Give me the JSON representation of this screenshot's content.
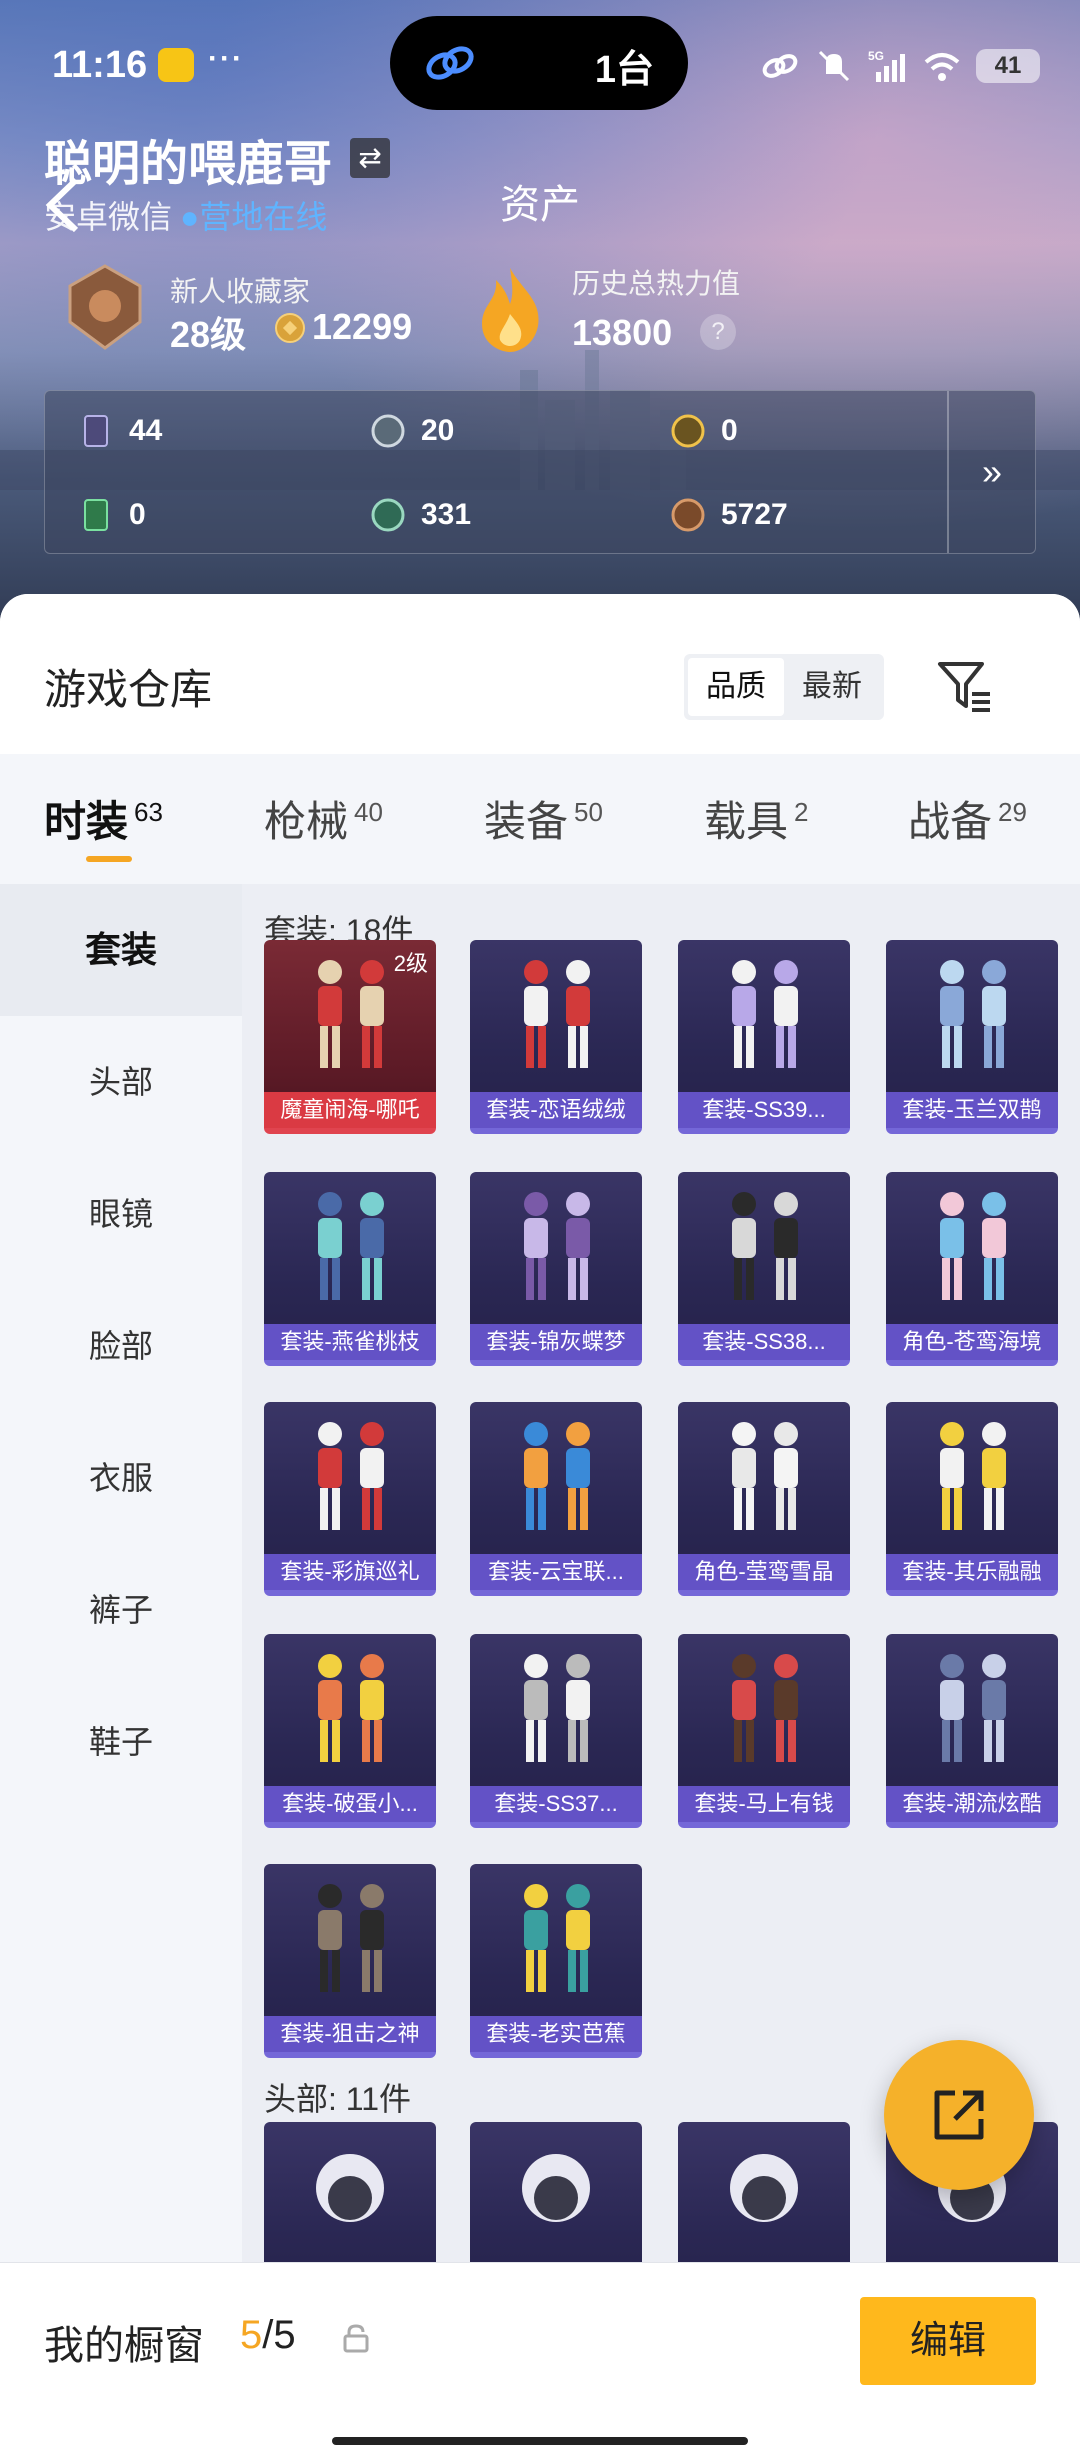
{
  "statusbar": {
    "time": "11:16",
    "dots": "···",
    "island_text": "1台",
    "battery": "41"
  },
  "header": {
    "title": "资产",
    "user_name": "聪明的喂鹿哥",
    "platform": "安卓微信",
    "online": "●营地在线",
    "collector_label": "新人收藏家",
    "level": "28级",
    "coins": "12299",
    "heat_label": "历史总热力值",
    "heat_value": "13800",
    "help": "?"
  },
  "assets": [
    {
      "value": "44",
      "icon": "card-icon"
    },
    {
      "value": "20",
      "icon": "silver-coin-icon"
    },
    {
      "value": "0",
      "icon": "gold-coin-icon"
    },
    {
      "value": "0",
      "icon": "ticket-icon"
    },
    {
      "value": "331",
      "icon": "green-orb-icon"
    },
    {
      "value": "5727",
      "icon": "bronze-coin-icon"
    }
  ],
  "assets_more": "»",
  "warehouse": {
    "title": "游戏仓库",
    "sort_options": [
      "品质",
      "最新"
    ],
    "tabs": [
      {
        "label": "时装",
        "count": "63"
      },
      {
        "label": "枪械",
        "count": "40"
      },
      {
        "label": "装备",
        "count": "50"
      },
      {
        "label": "载具",
        "count": "2"
      },
      {
        "label": "战备",
        "count": "29"
      }
    ],
    "side_items": [
      "套装",
      "头部",
      "眼镜",
      "脸部",
      "衣服",
      "裤子",
      "鞋子"
    ],
    "section1_title": "套装: 18件",
    "section2_title": "头部: 11件",
    "items": [
      {
        "name": "魔童闹海-哪吒",
        "level": "2级"
      },
      {
        "name": "套装-恋语绒绒"
      },
      {
        "name": "套装-SS39..."
      },
      {
        "name": "套装-玉兰双鹊"
      },
      {
        "name": "套装-燕雀桃枝"
      },
      {
        "name": "套装-锦灰蝶梦"
      },
      {
        "name": "套装-SS38..."
      },
      {
        "name": "角色-苍鸾海境"
      },
      {
        "name": "套装-彩旗巡礼"
      },
      {
        "name": "套装-云宝联..."
      },
      {
        "name": "角色-莹鸾雪晶"
      },
      {
        "name": "套装-其乐融融"
      },
      {
        "name": "套装-破蛋小..."
      },
      {
        "name": "套装-SS37..."
      },
      {
        "name": "套装-马上有钱"
      },
      {
        "name": "套装-潮流炫酷"
      },
      {
        "name": "套装-狙击之神"
      },
      {
        "name": "套装-老实芭蕉"
      }
    ]
  },
  "showcase": {
    "label": "我的橱窗",
    "current": "5",
    "total": "/5",
    "edit_label": "编辑"
  }
}
